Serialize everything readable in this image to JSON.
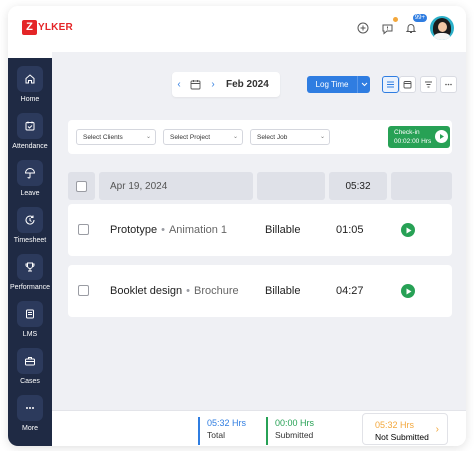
{
  "app": {
    "logo_letter": "Z",
    "logo_text": "YLKER",
    "brand_color": "#e42527",
    "accent_color": "#2f7de1",
    "success_color": "#27a155",
    "warning_color": "#f3a73b",
    "notification_badge": "99+"
  },
  "header_icons": [
    "add-icon",
    "chat-icon",
    "bell-icon",
    "avatar"
  ],
  "sidebar": {
    "items": [
      {
        "label": "Home",
        "icon": "home-icon"
      },
      {
        "label": "Attendance",
        "icon": "calendar-check-icon"
      },
      {
        "label": "Leave",
        "icon": "umbrella-icon"
      },
      {
        "label": "Timesheet",
        "icon": "clock-refresh-icon"
      },
      {
        "label": "Performance",
        "icon": "trophy-icon"
      },
      {
        "label": "LMS",
        "icon": "book-icon"
      },
      {
        "label": "Cases",
        "icon": "briefcase-icon"
      },
      {
        "label": "More",
        "icon": "more-dots-icon"
      }
    ]
  },
  "toolbar": {
    "period": "Feb 2024",
    "log_time_label": "Log Time",
    "prev_icon": "chevron-left-icon",
    "next_icon": "chevron-right-icon"
  },
  "filters": {
    "client_placeholder": "Select Clients",
    "project_placeholder": "Select Project",
    "job_placeholder": "Select Job",
    "checkin_label": "Check-in",
    "checkin_time": "00:02:00 Hrs"
  },
  "table": {
    "date": "Apr 19, 2024",
    "total_hours": "05:32",
    "rows": [
      {
        "project": "Prototype",
        "task": "Animation 1",
        "billing": "Billable",
        "hours": "01:05"
      },
      {
        "project": "Booklet design",
        "task": "Brochure",
        "billing": "Billable",
        "hours": "04:27"
      }
    ]
  },
  "footer": {
    "total_value": "05:32 Hrs",
    "total_label": "Total",
    "submitted_value": "00:00 Hrs",
    "submitted_label": "Submitted",
    "not_submitted_value": "05:32 Hrs",
    "not_submitted_label": "Not Submitted"
  }
}
